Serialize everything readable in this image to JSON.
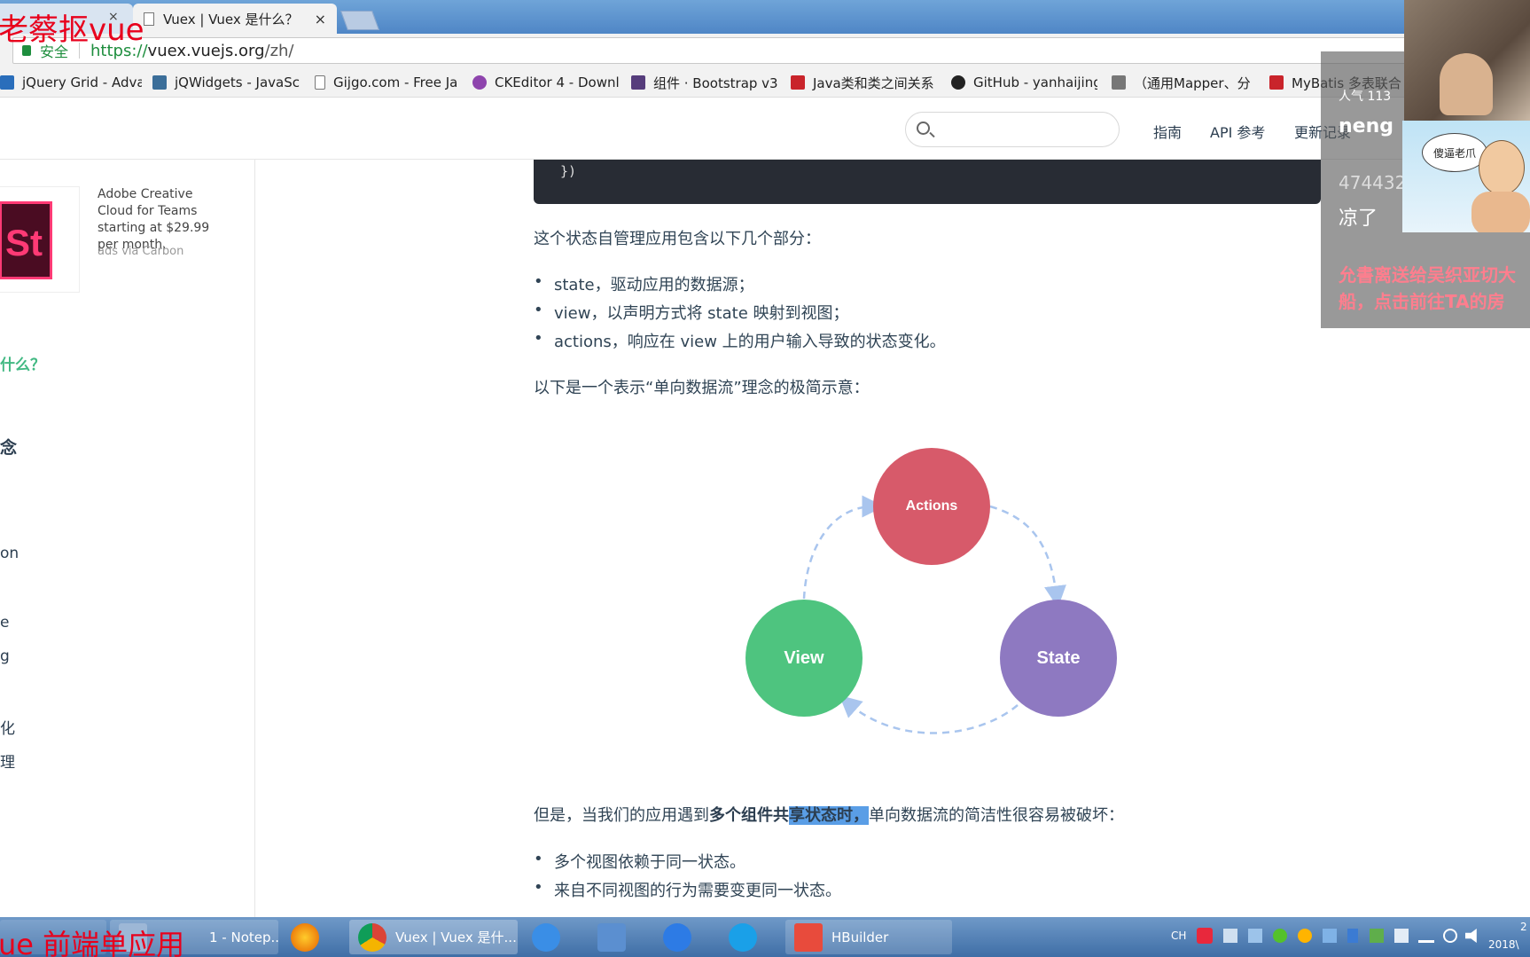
{
  "browser": {
    "tabs": [
      {
        "title": "",
        "close": "×"
      },
      {
        "title": "Vuex | Vuex 是什么？",
        "close": "×"
      }
    ],
    "secure_label": "安全",
    "url_scheme": "https://",
    "url_host": "vuex.vuejs.org",
    "url_path": "/zh/"
  },
  "bookmarks": [
    {
      "label": "jQuery Grid - Adva",
      "icon_color": "#2a6ebb",
      "icon": "jqgrid-icon"
    },
    {
      "label": "jQWidgets - JavaSc",
      "icon_color": "#3b6e99",
      "icon": "jqwidgets-icon"
    },
    {
      "label": "Gijgo.com - Free Ja",
      "icon_color": "#ffffff",
      "icon": "page-icon"
    },
    {
      "label": "CKEditor 4 - Downl",
      "icon_color": "#8e44ad",
      "icon": "ckeditor-icon"
    },
    {
      "label": "组件 · Bootstrap v3",
      "icon_color": "#563d7c",
      "icon": "bootstrap-icon"
    },
    {
      "label": "Java类和类之间关系",
      "icon_color": "#c9242b",
      "icon": "csdn-icon"
    },
    {
      "label": "GitHub - yanhaijing",
      "icon_color": "#222222",
      "icon": "github-icon"
    },
    {
      "label": "（通用Mapper、分",
      "icon_color": "#666666",
      "icon": "mapper-icon"
    },
    {
      "label": "MyBatis 多表联合",
      "icon_color": "#c9242b",
      "icon": "csdn-icon"
    }
  ],
  "header": {
    "search_placeholder": "",
    "nav": [
      "指南",
      "API 参考",
      "更新记录"
    ]
  },
  "sidebar": {
    "ad_logo_text": "St",
    "ad_text": "Adobe Creative Cloud for Teams starting at $29.99 per month.",
    "ad_via": "ads via Carbon",
    "items": [
      "什么？",
      "念",
      "on",
      "e",
      "g",
      "化",
      "理"
    ]
  },
  "content": {
    "code_line": "})",
    "p1": "这个状态自管理应用包含以下几个部分：",
    "bullets1": [
      "state，驱动应用的数据源；",
      "view，以声明方式将 state 映射到视图；",
      "actions，响应在 view 上的用户输入导致的状态变化。"
    ],
    "p2": "以下是一个表示“单向数据流”理念的极简示意：",
    "p3_a": "但是，当我们的应用遇到",
    "p3_b": "多个组件共",
    "p3_c": "享状态时，",
    "p3_d": "单向数据流的简洁性很容易被破坏：",
    "bullets2": [
      "多个视图依赖于同一状态。",
      "来自不同视图的行为需要变更同一状态。"
    ]
  },
  "diagram": {
    "nodes": [
      {
        "label": "Actions",
        "color": "#d75a6a"
      },
      {
        "label": "State",
        "color": "#8e79c1"
      },
      {
        "label": "View",
        "color": "#4ec47f"
      }
    ],
    "arrow_color": "#a9c5ee"
  },
  "overlay": {
    "top_left": "老蔡抠vue",
    "bottom_left": "ue 前端单应用",
    "popularity": "人气 113",
    "username": "neng",
    "number": "474432",
    "comment": "凉了",
    "gift_line1": "允書离送给吴织亚切大",
    "gift_line2": "船，点击前往TA的房",
    "bubble": "傻逼老爪"
  },
  "taskbar": {
    "items": [
      {
        "label": "1 - Notep...",
        "icon_color": "#9db7d6"
      },
      {
        "label": "",
        "icon_color": "#e66000"
      },
      {
        "label": "Vuex | Vuex 是什...",
        "icon_color": "#4285f4"
      },
      {
        "label": "",
        "icon_color": "#3a8ee6"
      },
      {
        "label": "",
        "icon_color": "#5b8fd0"
      },
      {
        "label": "",
        "icon_color": "#2d7be5"
      },
      {
        "label": "",
        "icon_color": "#1aa0e8"
      },
      {
        "label": "HBuilder",
        "icon_color": "#e84b3c"
      }
    ],
    "tray_lang": "CH",
    "clock_line1": "2",
    "clock_line2": "2018\\"
  }
}
